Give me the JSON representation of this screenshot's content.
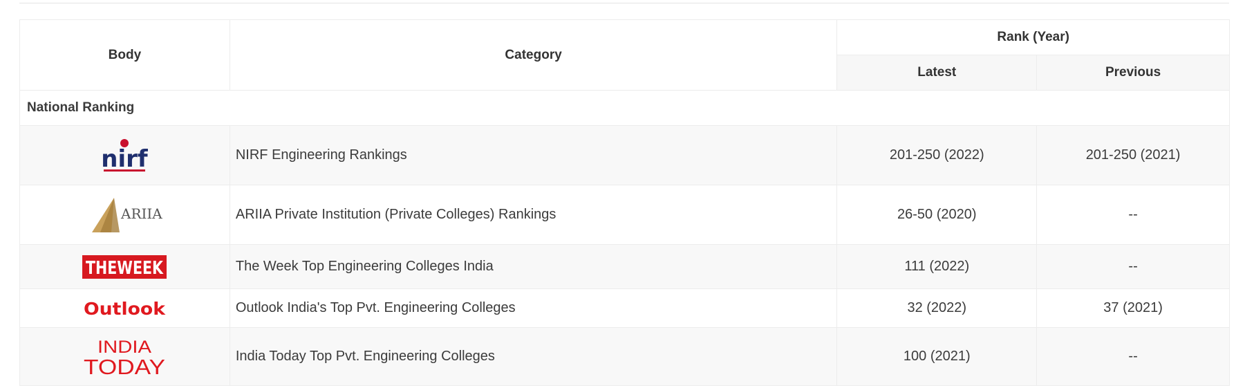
{
  "headers": {
    "body": "Body",
    "category": "Category",
    "rank_group": "Rank (Year)",
    "latest": "Latest",
    "previous": "Previous"
  },
  "section": "National Ranking",
  "rows": [
    {
      "logo": "nirf",
      "category": "NIRF Engineering Rankings",
      "latest": "201-250 (2022)",
      "previous": "201-250 (2021)"
    },
    {
      "logo": "ARIIA",
      "category": "ARIIA Private Institution (Private Colleges) Rankings",
      "latest": "26-50 (2020)",
      "previous": "--"
    },
    {
      "logo": "THEWEEK",
      "category": "The Week Top Engineering Colleges India",
      "latest": "111 (2022)",
      "previous": "--"
    },
    {
      "logo": "Outlook",
      "category": "Outlook India's Top Pvt. Engineering Colleges",
      "latest": "32 (2022)",
      "previous": "37 (2021)"
    },
    {
      "logo": "INDIA TODAY",
      "category": "India Today Top Pvt. Engineering Colleges",
      "latest": "100 (2021)",
      "previous": "--"
    }
  ],
  "colors": {
    "nirf_blue": "#1f2f6e",
    "nirf_red": "#c8102e",
    "ariia_gold": "#c9a15b",
    "theweek_red": "#d71920",
    "outlook_red": "#e0191f",
    "indiatoday_red": "#e0191f"
  }
}
